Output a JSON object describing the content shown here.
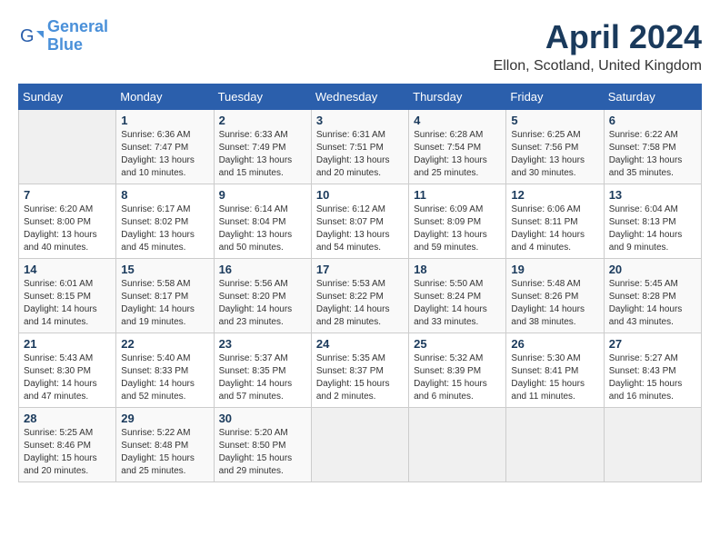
{
  "header": {
    "logo_line1": "General",
    "logo_line2": "Blue",
    "month": "April 2024",
    "location": "Ellon, Scotland, United Kingdom"
  },
  "weekdays": [
    "Sunday",
    "Monday",
    "Tuesday",
    "Wednesday",
    "Thursday",
    "Friday",
    "Saturday"
  ],
  "weeks": [
    [
      {
        "day": "",
        "info": ""
      },
      {
        "day": "1",
        "info": "Sunrise: 6:36 AM\nSunset: 7:47 PM\nDaylight: 13 hours\nand 10 minutes."
      },
      {
        "day": "2",
        "info": "Sunrise: 6:33 AM\nSunset: 7:49 PM\nDaylight: 13 hours\nand 15 minutes."
      },
      {
        "day": "3",
        "info": "Sunrise: 6:31 AM\nSunset: 7:51 PM\nDaylight: 13 hours\nand 20 minutes."
      },
      {
        "day": "4",
        "info": "Sunrise: 6:28 AM\nSunset: 7:54 PM\nDaylight: 13 hours\nand 25 minutes."
      },
      {
        "day": "5",
        "info": "Sunrise: 6:25 AM\nSunset: 7:56 PM\nDaylight: 13 hours\nand 30 minutes."
      },
      {
        "day": "6",
        "info": "Sunrise: 6:22 AM\nSunset: 7:58 PM\nDaylight: 13 hours\nand 35 minutes."
      }
    ],
    [
      {
        "day": "7",
        "info": "Sunrise: 6:20 AM\nSunset: 8:00 PM\nDaylight: 13 hours\nand 40 minutes."
      },
      {
        "day": "8",
        "info": "Sunrise: 6:17 AM\nSunset: 8:02 PM\nDaylight: 13 hours\nand 45 minutes."
      },
      {
        "day": "9",
        "info": "Sunrise: 6:14 AM\nSunset: 8:04 PM\nDaylight: 13 hours\nand 50 minutes."
      },
      {
        "day": "10",
        "info": "Sunrise: 6:12 AM\nSunset: 8:07 PM\nDaylight: 13 hours\nand 54 minutes."
      },
      {
        "day": "11",
        "info": "Sunrise: 6:09 AM\nSunset: 8:09 PM\nDaylight: 13 hours\nand 59 minutes."
      },
      {
        "day": "12",
        "info": "Sunrise: 6:06 AM\nSunset: 8:11 PM\nDaylight: 14 hours\nand 4 minutes."
      },
      {
        "day": "13",
        "info": "Sunrise: 6:04 AM\nSunset: 8:13 PM\nDaylight: 14 hours\nand 9 minutes."
      }
    ],
    [
      {
        "day": "14",
        "info": "Sunrise: 6:01 AM\nSunset: 8:15 PM\nDaylight: 14 hours\nand 14 minutes."
      },
      {
        "day": "15",
        "info": "Sunrise: 5:58 AM\nSunset: 8:17 PM\nDaylight: 14 hours\nand 19 minutes."
      },
      {
        "day": "16",
        "info": "Sunrise: 5:56 AM\nSunset: 8:20 PM\nDaylight: 14 hours\nand 23 minutes."
      },
      {
        "day": "17",
        "info": "Sunrise: 5:53 AM\nSunset: 8:22 PM\nDaylight: 14 hours\nand 28 minutes."
      },
      {
        "day": "18",
        "info": "Sunrise: 5:50 AM\nSunset: 8:24 PM\nDaylight: 14 hours\nand 33 minutes."
      },
      {
        "day": "19",
        "info": "Sunrise: 5:48 AM\nSunset: 8:26 PM\nDaylight: 14 hours\nand 38 minutes."
      },
      {
        "day": "20",
        "info": "Sunrise: 5:45 AM\nSunset: 8:28 PM\nDaylight: 14 hours\nand 43 minutes."
      }
    ],
    [
      {
        "day": "21",
        "info": "Sunrise: 5:43 AM\nSunset: 8:30 PM\nDaylight: 14 hours\nand 47 minutes."
      },
      {
        "day": "22",
        "info": "Sunrise: 5:40 AM\nSunset: 8:33 PM\nDaylight: 14 hours\nand 52 minutes."
      },
      {
        "day": "23",
        "info": "Sunrise: 5:37 AM\nSunset: 8:35 PM\nDaylight: 14 hours\nand 57 minutes."
      },
      {
        "day": "24",
        "info": "Sunrise: 5:35 AM\nSunset: 8:37 PM\nDaylight: 15 hours\nand 2 minutes."
      },
      {
        "day": "25",
        "info": "Sunrise: 5:32 AM\nSunset: 8:39 PM\nDaylight: 15 hours\nand 6 minutes."
      },
      {
        "day": "26",
        "info": "Sunrise: 5:30 AM\nSunset: 8:41 PM\nDaylight: 15 hours\nand 11 minutes."
      },
      {
        "day": "27",
        "info": "Sunrise: 5:27 AM\nSunset: 8:43 PM\nDaylight: 15 hours\nand 16 minutes."
      }
    ],
    [
      {
        "day": "28",
        "info": "Sunrise: 5:25 AM\nSunset: 8:46 PM\nDaylight: 15 hours\nand 20 minutes."
      },
      {
        "day": "29",
        "info": "Sunrise: 5:22 AM\nSunset: 8:48 PM\nDaylight: 15 hours\nand 25 minutes."
      },
      {
        "day": "30",
        "info": "Sunrise: 5:20 AM\nSunset: 8:50 PM\nDaylight: 15 hours\nand 29 minutes."
      },
      {
        "day": "",
        "info": ""
      },
      {
        "day": "",
        "info": ""
      },
      {
        "day": "",
        "info": ""
      },
      {
        "day": "",
        "info": ""
      }
    ]
  ]
}
